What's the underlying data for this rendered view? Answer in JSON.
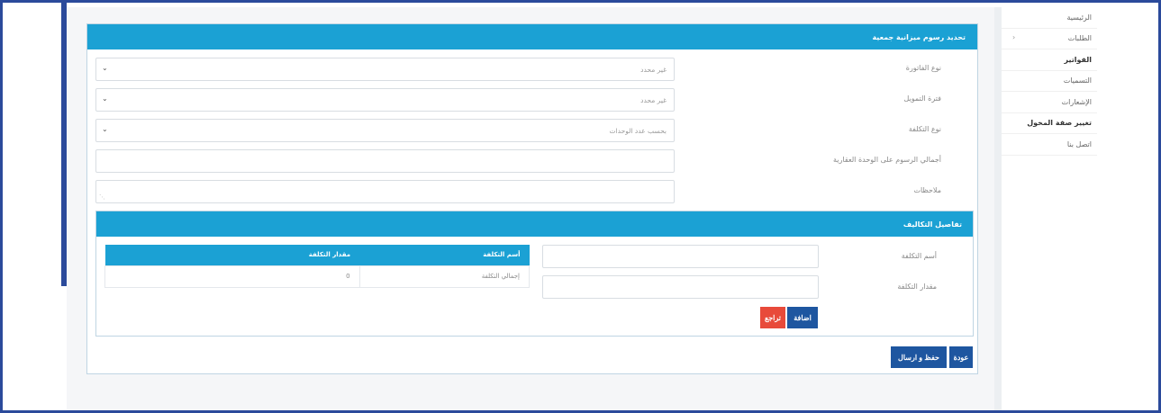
{
  "sidebar": {
    "items": [
      {
        "label": "الرئيسية",
        "active": false
      },
      {
        "label": "الطلبات",
        "active": false,
        "has_arrow": true
      },
      {
        "label": "الفواتير",
        "active": true
      },
      {
        "label": "التسميات",
        "active": false
      },
      {
        "label": "الإشعارات",
        "active": false
      },
      {
        "label": "تغيير صفة المخول",
        "active": true
      },
      {
        "label": "اتصل بنا",
        "active": false
      }
    ],
    "arrow_icon": "‹"
  },
  "card": {
    "title": "تحديد رسوم ميزانية جمعية"
  },
  "form": {
    "invoice_type": {
      "label": "نوع الفاتورة",
      "value": "غير محدد"
    },
    "financing_period": {
      "label": "فترة التمويل",
      "value": "غير محدد"
    },
    "cost_type": {
      "label": "نوع التكلفة",
      "value": "بحسب عدد الوحدات"
    },
    "total_fees": {
      "label": "أجمالي الرسوم على الوحدة العقارية",
      "value": ""
    },
    "notes": {
      "label": "ملاحظات",
      "value": ""
    },
    "caret": "⌄"
  },
  "cost_details": {
    "title": "تفاصيل التكاليف",
    "cost_name_label": "أسم التكلفة",
    "cost_amount_label": "مقدار التكلفة",
    "table_headers": [
      "أسم التكلفة",
      "مقدار التكلفة"
    ],
    "table_rows": [
      [
        "إجمالي التكلفة",
        "0"
      ]
    ],
    "add_button": "اضافة",
    "back_button": "تراجع"
  },
  "footer": {
    "back_button": "عودة",
    "save_send_button": "حفظ و ارسال"
  },
  "colors": {
    "header": "#1ba1d4",
    "primary_button": "#1e56a0",
    "danger_button": "#e84a3a",
    "frame": "#2b4a9b"
  }
}
